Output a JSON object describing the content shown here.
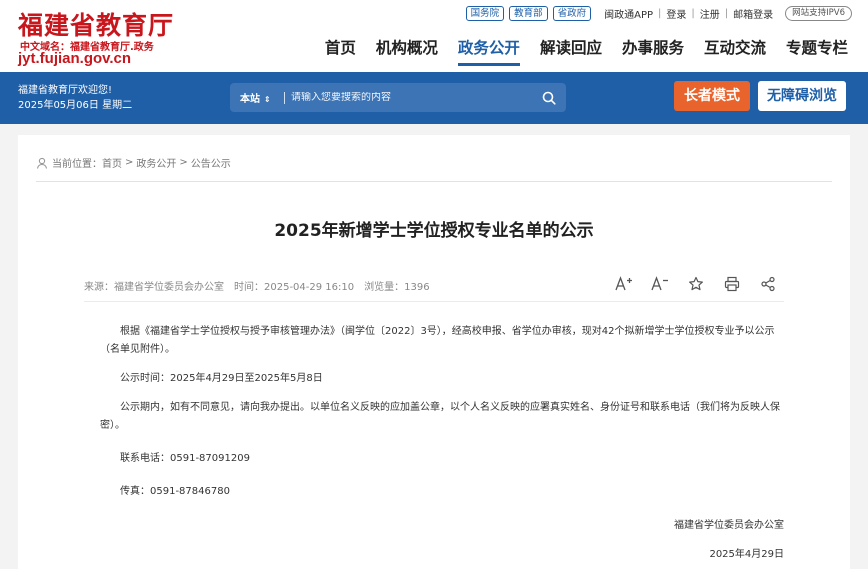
{
  "header": {
    "site_title": "福建省教育厅",
    "domain_cn": "中文域名：福建省教育厅.政务",
    "domain_en": "jyt.fujian.gov.cn",
    "gov_links": [
      "国务院",
      "教育部",
      "省政府"
    ],
    "app_link": "闽政通APP",
    "login": "登录",
    "register": "注册",
    "mail_login": "邮箱登录",
    "ipv6": "网站支持IPV6",
    "nav": [
      "首页",
      "机构概况",
      "政务公开",
      "解读回应",
      "办事服务",
      "互动交流",
      "专题专栏"
    ],
    "nav_active": "政务公开"
  },
  "bluebar": {
    "welcome": "福建省教育厅欢迎您!",
    "date": "2025年05月06日 星期二",
    "search_scope": "本站",
    "search_placeholder": "请输入您要搜索的内容",
    "elder_mode": "长者模式",
    "accessible": "无障碍浏览"
  },
  "breadcrumb": {
    "label": "当前位置：",
    "items": [
      "首页",
      "政务公开",
      "公告公示"
    ]
  },
  "article": {
    "title": "2025年新增学士学位授权专业名单的公示",
    "source": "来源：福建省学位委员会办公室",
    "time": "时间：2025-04-29 16:10",
    "views": "浏览量：1396",
    "paragraphs": [
      "根据《福建省学士学位授权与授予审核管理办法》（闽学位〔2022〕3号），经高校申报、省学位办审核，现对42个拟新增学士学位授权专业予以公示（名单见附件）。",
      "公示时间：2025年4月29日至2025年5月8日",
      "公示期内，如有不同意见，请向我办提出。以单位名义反映的应加盖公章，以个人名义反映的应署真实姓名、身份证号和联系电话（我们将为反映人保密）。",
      "联系电话：0591-87091209",
      "传真：0591-87846780"
    ],
    "sign_org": "福建省学位委员会办公室",
    "sign_date": "2025年4月29日"
  },
  "colors": {
    "brand_red": "#c8161d",
    "brand_blue": "#1e5fa8",
    "elder_orange": "#e8642c"
  },
  "icons": [
    "search-icon",
    "location-icon",
    "font-increase-icon",
    "font-decrease-icon",
    "star-icon",
    "print-icon",
    "share-icon"
  ]
}
